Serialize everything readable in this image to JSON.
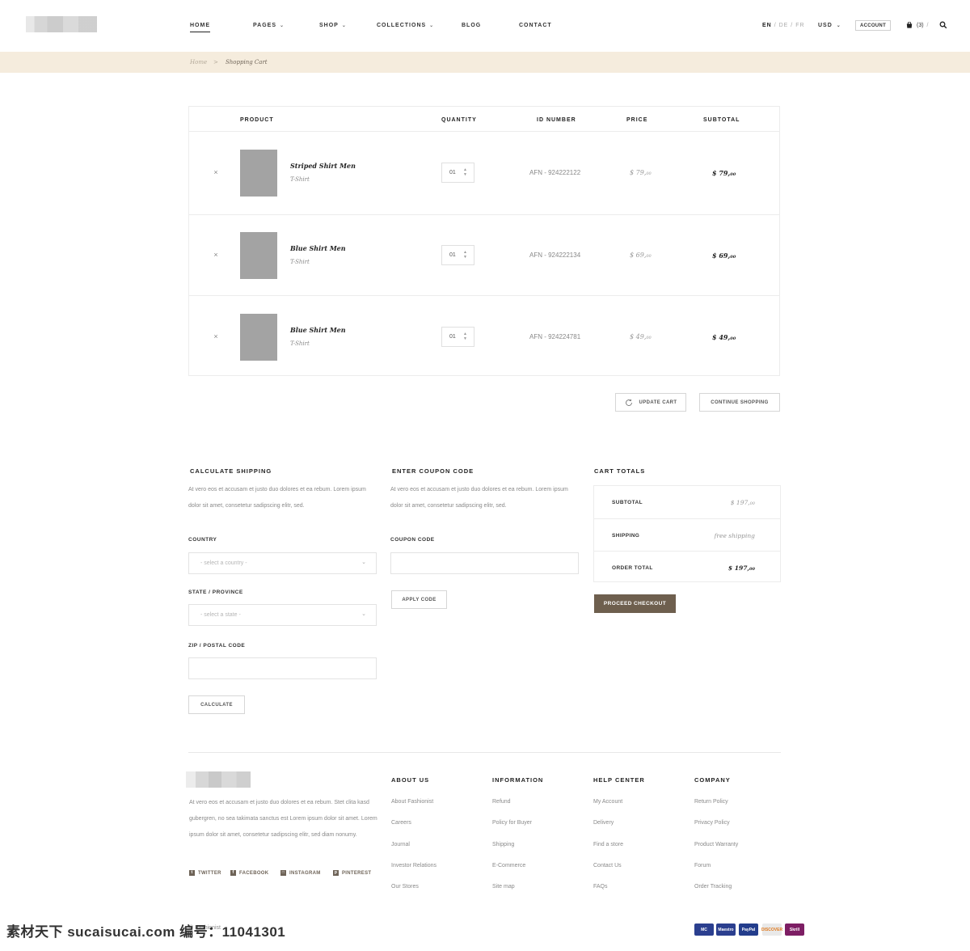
{
  "header": {
    "nav": [
      {
        "label": "HOME",
        "active": true,
        "dropdown": false
      },
      {
        "label": "PAGES",
        "active": false,
        "dropdown": true
      },
      {
        "label": "SHOP",
        "active": false,
        "dropdown": true
      },
      {
        "label": "COLLECTIONS",
        "active": false,
        "dropdown": true
      },
      {
        "label": "BLOG",
        "active": false,
        "dropdown": false
      },
      {
        "label": "CONTACT",
        "active": false,
        "dropdown": false
      }
    ],
    "lang": {
      "current": "EN",
      "others": [
        "DE",
        "FR"
      ],
      "separator": "/"
    },
    "currency": "USD",
    "account_label": "ACCOUNT",
    "cart_count": "(3)",
    "cart_sep": "/",
    "icons": {
      "cart": "shopping-bag-icon",
      "search": "search-icon",
      "chevron": "chevron-down-icon"
    }
  },
  "breadcrumb": {
    "home": "Home",
    "arrow": ">",
    "current": "Shopping Cart"
  },
  "cart": {
    "headers": {
      "product": "PRODUCT",
      "quantity": "QUANTITY",
      "id": "ID NUMBER",
      "price": "PRICE",
      "subtotal": "SUBTOTAL"
    },
    "items": [
      {
        "name": "Striped Shirt Men",
        "type": "T-Shirt",
        "qty": "01",
        "id": "AFN - 924222122",
        "price": "$ 79,",
        "price_cents": "00",
        "subtotal": "$ 79,",
        "subtotal_cents": "00"
      },
      {
        "name": "Blue Shirt Men",
        "type": "T-Shirt",
        "qty": "01",
        "id": "AFN - 924222134",
        "price": "$ 69,",
        "price_cents": "00",
        "subtotal": "$ 69,",
        "subtotal_cents": "00"
      },
      {
        "name": "Blue Shirt Men",
        "type": "T-Shirt",
        "qty": "01",
        "id": "AFN - 924224781",
        "price": "$ 49,",
        "price_cents": "00",
        "subtotal": "$ 49,",
        "subtotal_cents": "00"
      }
    ],
    "remove_glyph": "×",
    "update_label": "UPDATE CART",
    "continue_label": "CONTINUE SHOPPING"
  },
  "shipping": {
    "title": "CALCULATE SHIPPING",
    "text": "At vero eos et accusam et justo duo dolores et ea rebum. Lorem ipsum dolor sit amet, consetetur sadipscing elitr, sed.",
    "country_label": "COUNTRY",
    "country_placeholder": "- select a country -",
    "state_label": "STATE / PROVINCE",
    "state_placeholder": "- select a state -",
    "zip_label": "ZIP / POSTAL CODE",
    "calculate_label": "CALCULATE"
  },
  "coupon": {
    "title": "ENTER COUPON CODE",
    "text": "At vero eos et accusam et justo duo dolores et ea rebum. Lorem ipsum dolor sit amet, consetetur sadipscing elitr, sed.",
    "code_label": "COUPON CODE",
    "apply_label": "APPLY CODE"
  },
  "totals": {
    "title": "CART TOTALS",
    "subtotal_label": "SUBTOTAL",
    "subtotal_value": "$ 197,",
    "subtotal_cents": "00",
    "shipping_label": "SHIPPING",
    "shipping_value": "free shipping",
    "order_label": "ORDER TOTAL",
    "order_value": "$ 197,",
    "order_cents": "00",
    "checkout_label": "PROCEED CHECKOUT"
  },
  "footer": {
    "about_text": "At vero eos et accusam et justo duo dolores et ea rebum. Stet clita kasd gubergren, no sea takimata sanctus est Lorem ipsum dolor sit amet. Lorem ipsum dolor sit amet, consetetur sadipscing elitr, sed diam nonumy.",
    "social": [
      "TWITTER",
      "FACEBOOK",
      "INSTAGRAM",
      "PINTEREST"
    ],
    "columns": [
      {
        "title": "ABOUT US",
        "links": [
          "About Fashionist",
          "Careers",
          "Journal",
          "Investor Relations",
          "Our Stores"
        ]
      },
      {
        "title": "INFORMATION",
        "links": [
          "Refund",
          "Policy for Buyer",
          "Shipping",
          "E-Commerce",
          "Site map"
        ]
      },
      {
        "title": "HELP CENTER",
        "links": [
          "My Account",
          "Delivery",
          "Find a store",
          "Contact Us",
          "FAQs"
        ]
      },
      {
        "title": "COMPANY",
        "links": [
          "Return Policy",
          "Privacy Policy",
          "Product Warranty",
          "Forum",
          "Order Tracking"
        ]
      }
    ],
    "copyright": "© Fashionist",
    "payments": [
      {
        "label": "MC",
        "color": "#2b3f8f"
      },
      {
        "label": "Maestro",
        "color": "#2b3f8f"
      },
      {
        "label": "PayPal",
        "color": "#233d8c"
      },
      {
        "label": "DISCOVER",
        "color": "#e9e9e9"
      },
      {
        "label": "Skrill",
        "color": "#7d1e64"
      }
    ]
  },
  "watermark": "素材天下 sucaisucai.com  编号：11041301"
}
